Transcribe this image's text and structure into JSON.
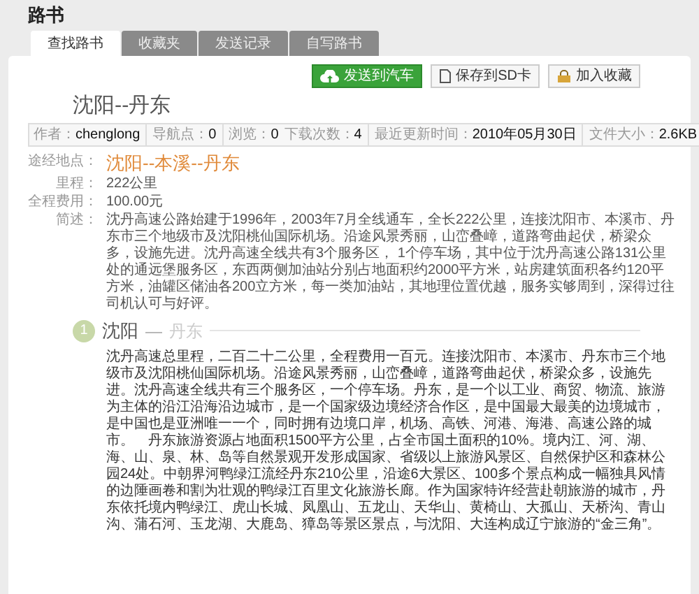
{
  "header": {
    "title": "路书"
  },
  "tabs": [
    {
      "label": "查找路书",
      "selected": true
    },
    {
      "label": "收藏夹",
      "selected": false
    },
    {
      "label": "发送记录",
      "selected": false
    },
    {
      "label": "自写路书",
      "selected": false
    }
  ],
  "actions": [
    {
      "kind": "send",
      "label": "发送到汽车"
    },
    {
      "kind": "save",
      "label": "保存到SD卡"
    },
    {
      "kind": "favorite",
      "label": "加入收藏"
    }
  ],
  "route_title": "沈阳--丹东",
  "meta": [
    [
      {
        "label": "作者：",
        "value": "chenglong"
      }
    ],
    [
      {
        "label": "导航点：",
        "value": "0"
      }
    ],
    [
      {
        "label": "浏览：",
        "value": "0"
      },
      {
        "label": "下载次数：",
        "value": "4"
      }
    ],
    [
      {
        "label": "最近更新时间：",
        "value": "2010年05月30日"
      }
    ],
    [
      {
        "label": "文件大小：",
        "value": "2.6KB"
      }
    ]
  ],
  "details": [
    {
      "kind": "highlight",
      "label": "途经地点：",
      "value": "沈阳--本溪--丹东"
    },
    {
      "kind": "text",
      "label": "里程：",
      "value": "222公里"
    },
    {
      "kind": "text",
      "label": "全程费用：",
      "value": "100.00元"
    },
    {
      "kind": "text",
      "label": "简述：",
      "value": "沈丹高速公路始建于1996年，2003年7月全线通车，全长222公里，连接沈阳市、本溪市、丹东市三个地级市及沈阳桃仙国际机场。沿途风景秀丽，山峦叠嶂，道路弯曲起伏，桥梁众多，设施先进。沈丹高速全线共有3个服务区， 1个停车场，其中位于沈丹高速公路131公里处的通远堡服务区，东西两侧加油站分别占地面积约2000平方米，站房建筑面积各约120平方米，油罐区储油各200立方米，每一类加油站，其地理位置优越，服务实够周到，深得过往司机认可与好评。"
    }
  ],
  "steps": [
    {
      "number": "1",
      "from": "沈阳",
      "separator": "—",
      "to": "丹东",
      "text": "沈丹高速总里程，二百二十二公里，全程费用一百元。连接沈阳市、本溪市、丹东市三个地级市及沈阳桃仙国际机场。沿途风景秀丽，山峦叠嶂，道路弯曲起伏，桥梁众多，设施先进。沈丹高速全线共有三个服务区，一个停车场。丹东，是一个以工业、商贸、物流、旅游为主体的沿江沿海沿边城市，是一个国家级边境经济合作区，是中国最大最美的边境城市，是中国也是亚洲唯一一个，同时拥有边境口岸，机场、高铁、河港、海港、高速公路的城市。　丹东旅游资源占地面积1500平方公里，占全市国土面积的10%。境内江、河、湖、海、山、泉、林、岛等自然景观开发形成国家、省级以上旅游风景区、自然保护区和森林公园24处。中朝界河鸭绿江流经丹东210公里，沿途6大景区、100多个景点构成一幅独具风情的边陲画卷和割为壮观的鸭绿江百里文化旅游长廊。作为国家特许经营赴朝旅游的城市，丹东依托境内鸭绿江、虎山长城、凤凰山、五龙山、天华山、黄椅山、大孤山、天桥沟、青山沟、蒲石河、玉龙湖、大鹿岛、獐岛等景区景点，与沈阳、大连构成辽宁旅游的“金三角”。"
    }
  ]
}
